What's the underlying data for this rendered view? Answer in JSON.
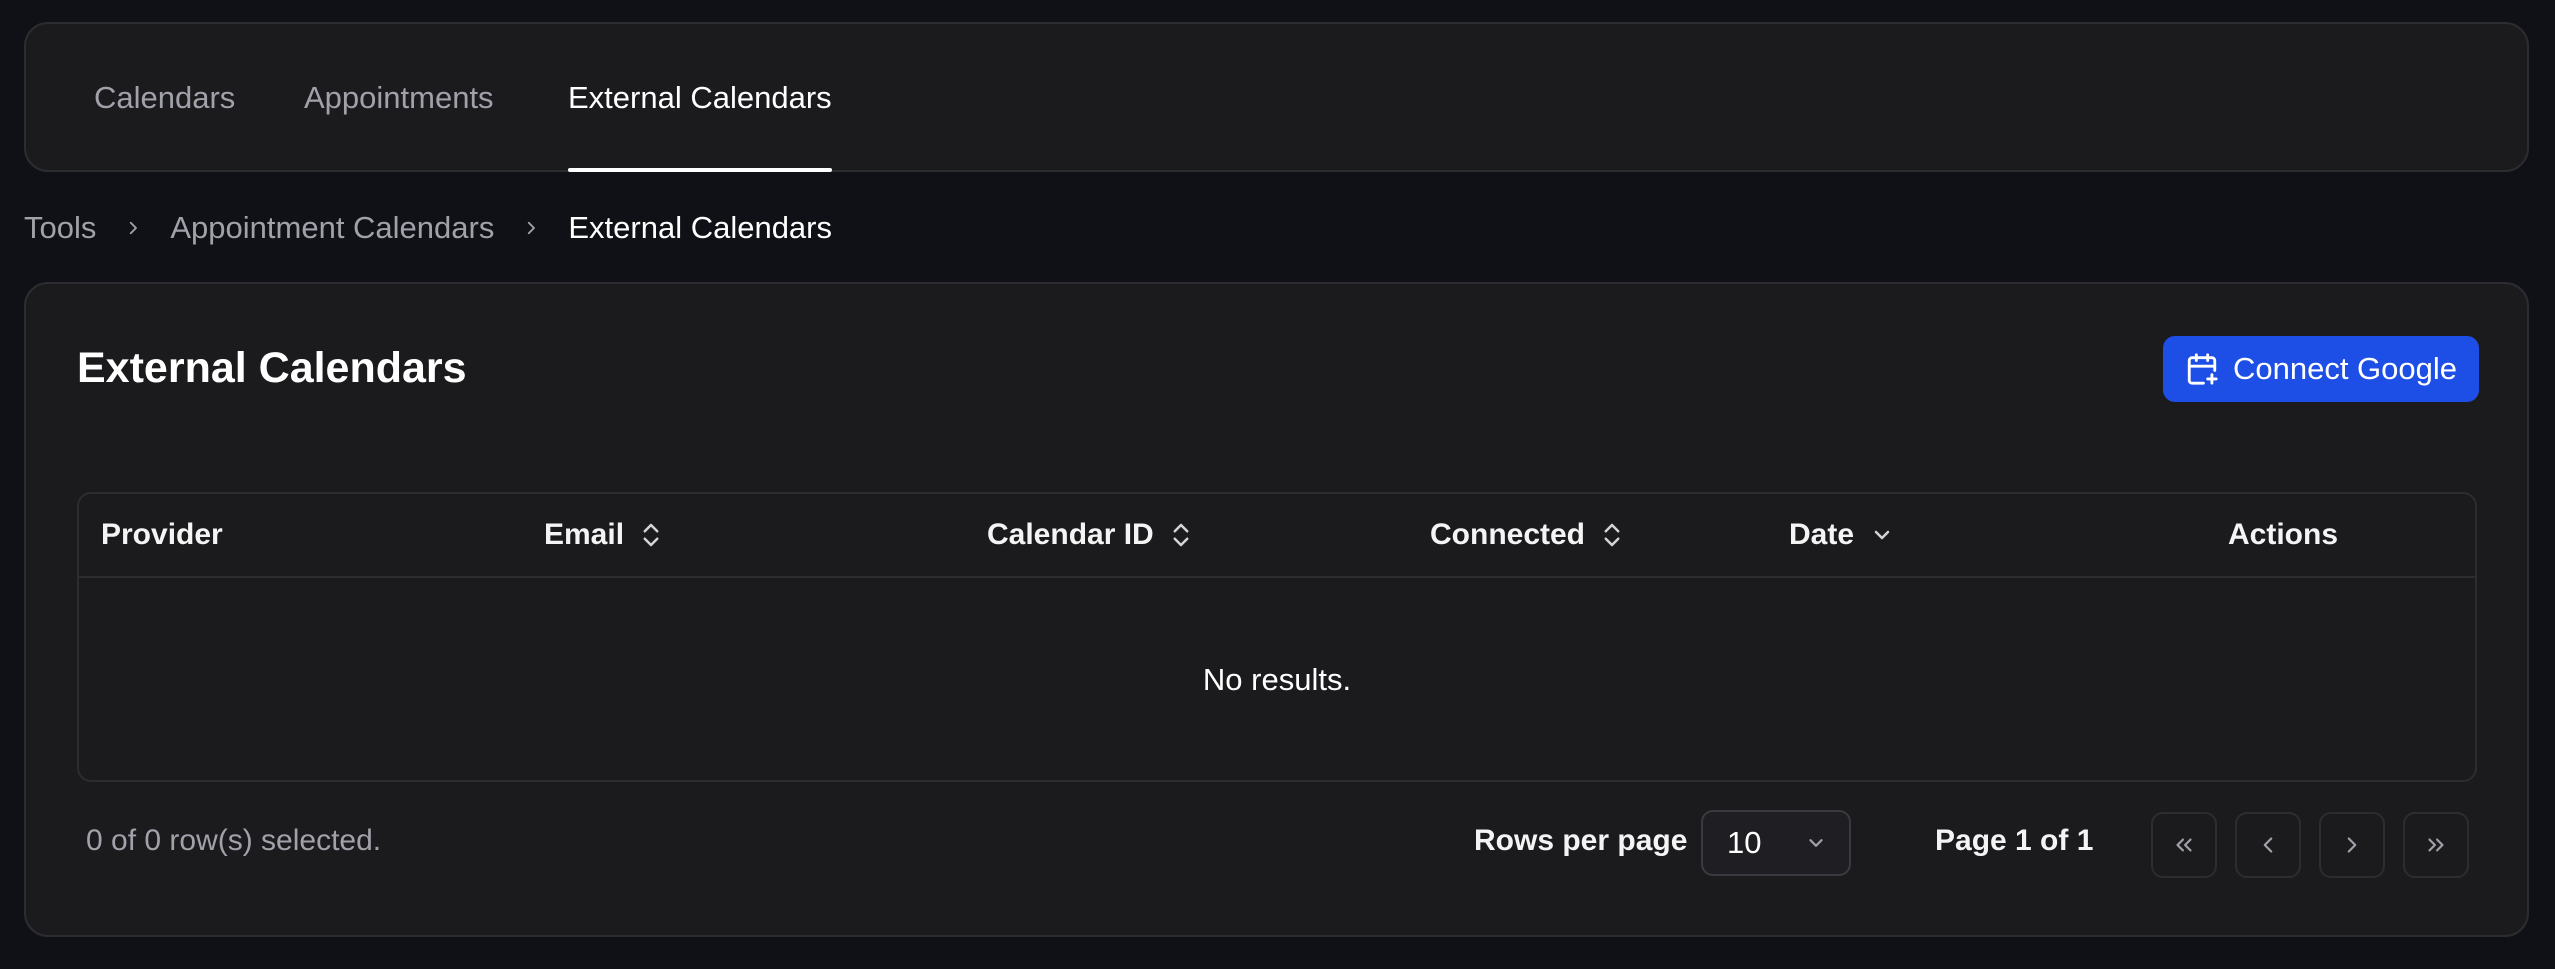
{
  "tabs": [
    {
      "label": "Calendars",
      "active": false
    },
    {
      "label": "Appointments",
      "active": false
    },
    {
      "label": "External Calendars",
      "active": true
    }
  ],
  "breadcrumb": [
    "Tools",
    "Appointment Calendars",
    "External Calendars"
  ],
  "page": {
    "title": "External Calendars",
    "connect_button": {
      "label": "Connect Google",
      "icon": "calendar-plus-icon",
      "color": "#1d4fe6"
    }
  },
  "table": {
    "columns": [
      {
        "label": "Provider",
        "sort": "none"
      },
      {
        "label": "Email",
        "sort": "sortable"
      },
      {
        "label": "Calendar ID",
        "sort": "sortable"
      },
      {
        "label": "Connected",
        "sort": "sortable"
      },
      {
        "label": "Date",
        "sort": "desc"
      },
      {
        "label": "Actions",
        "sort": "none"
      }
    ],
    "rows": [],
    "empty_text": "No results."
  },
  "footer": {
    "selection_text": "0 of 0 row(s) selected.",
    "rows_per_page_label": "Rows per page",
    "rows_per_page_value": "10",
    "page_label": "Page 1 of 1"
  }
}
